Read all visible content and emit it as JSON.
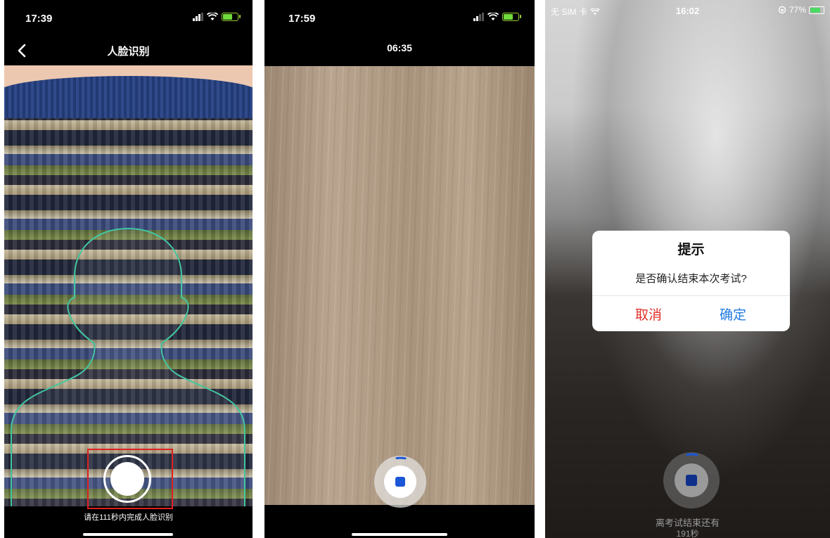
{
  "screen1": {
    "status": {
      "time": "17:39"
    },
    "nav": {
      "title": "人脸识别"
    },
    "hint": "请在111秒内完成人脸识别"
  },
  "screen2": {
    "status": {
      "time": "17:59"
    },
    "timer": "06:35"
  },
  "screen3": {
    "status": {
      "carrier": "无 SIM 卡",
      "time": "16:02",
      "battery": "77%"
    },
    "dialog": {
      "title": "提示",
      "message": "是否确认结束本次考试?",
      "cancel": "取消",
      "confirm": "确定"
    },
    "remaining_label": "离考试结束还有",
    "remaining_value": "191秒"
  },
  "colors": {
    "cancel_red": "#e0302a",
    "confirm_blue": "#1f7ae0",
    "stop_blue": "#1a56d6",
    "outline_green": "#43c6a0",
    "highlight_red": "#e02020"
  }
}
